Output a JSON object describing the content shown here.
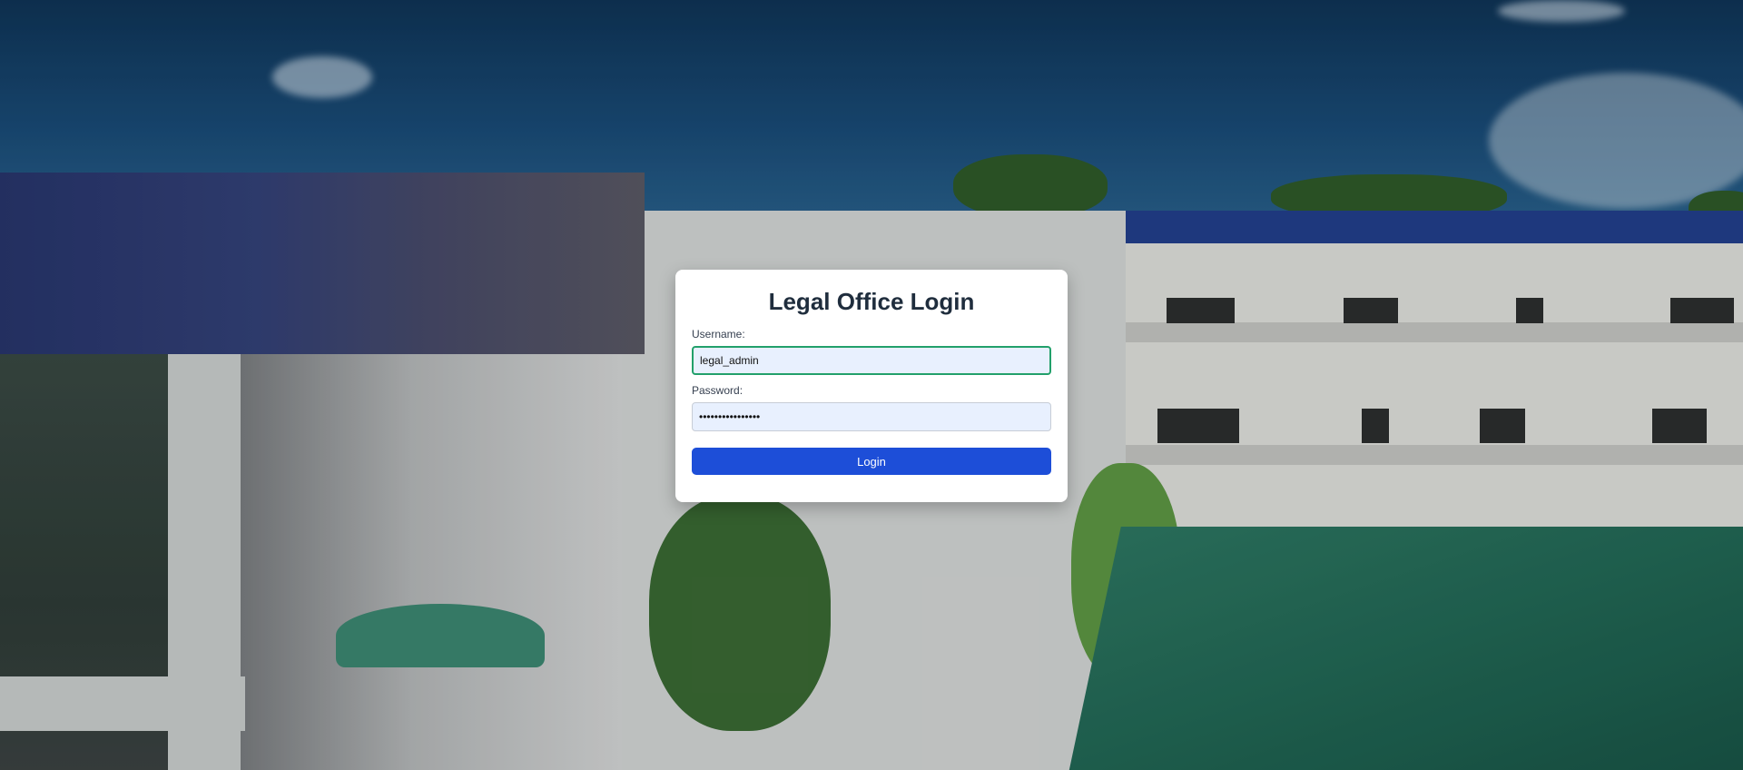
{
  "login": {
    "title": "Legal Office Login",
    "username_label": "Username:",
    "username_value": "legal_admin",
    "password_label": "Password:",
    "password_value": "••••••••••••••••",
    "submit_label": "Login"
  },
  "colors": {
    "button": "#1d4ed8",
    "input_background": "#e8f0fe",
    "focus_border": "#22a06b",
    "title": "#1f2d3d"
  }
}
